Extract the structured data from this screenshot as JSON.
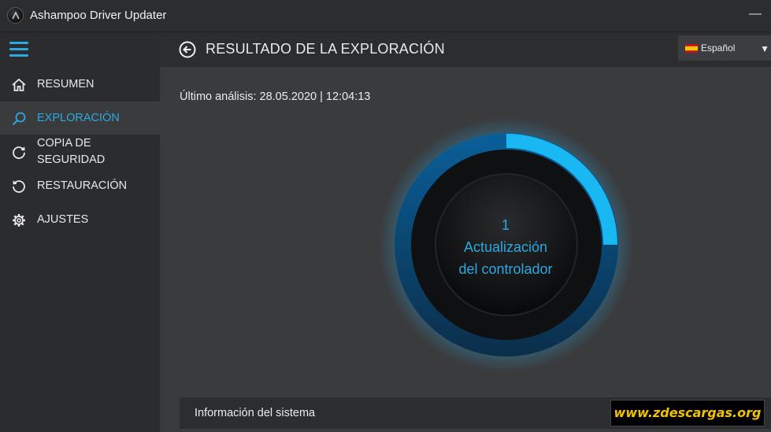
{
  "window": {
    "title": "Ashampoo Driver Updater",
    "minimize_glyph": "—"
  },
  "sidebar": {
    "items": [
      {
        "label": "RESUMEN",
        "icon": "home-icon"
      },
      {
        "label": "EXPLORACIÓN",
        "icon": "search-icon",
        "active": true
      },
      {
        "label": "COPIA DE\nSEGURIDAD",
        "icon": "backup-icon"
      },
      {
        "label": "RESTAURACIÓN",
        "icon": "restore-icon"
      },
      {
        "label": "AJUSTES",
        "icon": "gear-icon"
      }
    ]
  },
  "header": {
    "title": "RESULTADO DE LA EXPLORACIÓN",
    "language": {
      "selected": "Español",
      "flag": "spain-flag-icon"
    }
  },
  "main": {
    "last_scan": "Último análisis: 28.05.2020 | 12:04:13",
    "gauge": {
      "count": "1",
      "line1": "Actualización",
      "line2": "del controlador",
      "progress": 0.25
    },
    "system_info_label": "Información del sistema"
  },
  "watermark": "www.zdescargas.org",
  "colors": {
    "accent": "#2ea8e0",
    "background": "#3a3b3d",
    "panel": "#2c2d2f",
    "watermark": "#f2c200"
  }
}
